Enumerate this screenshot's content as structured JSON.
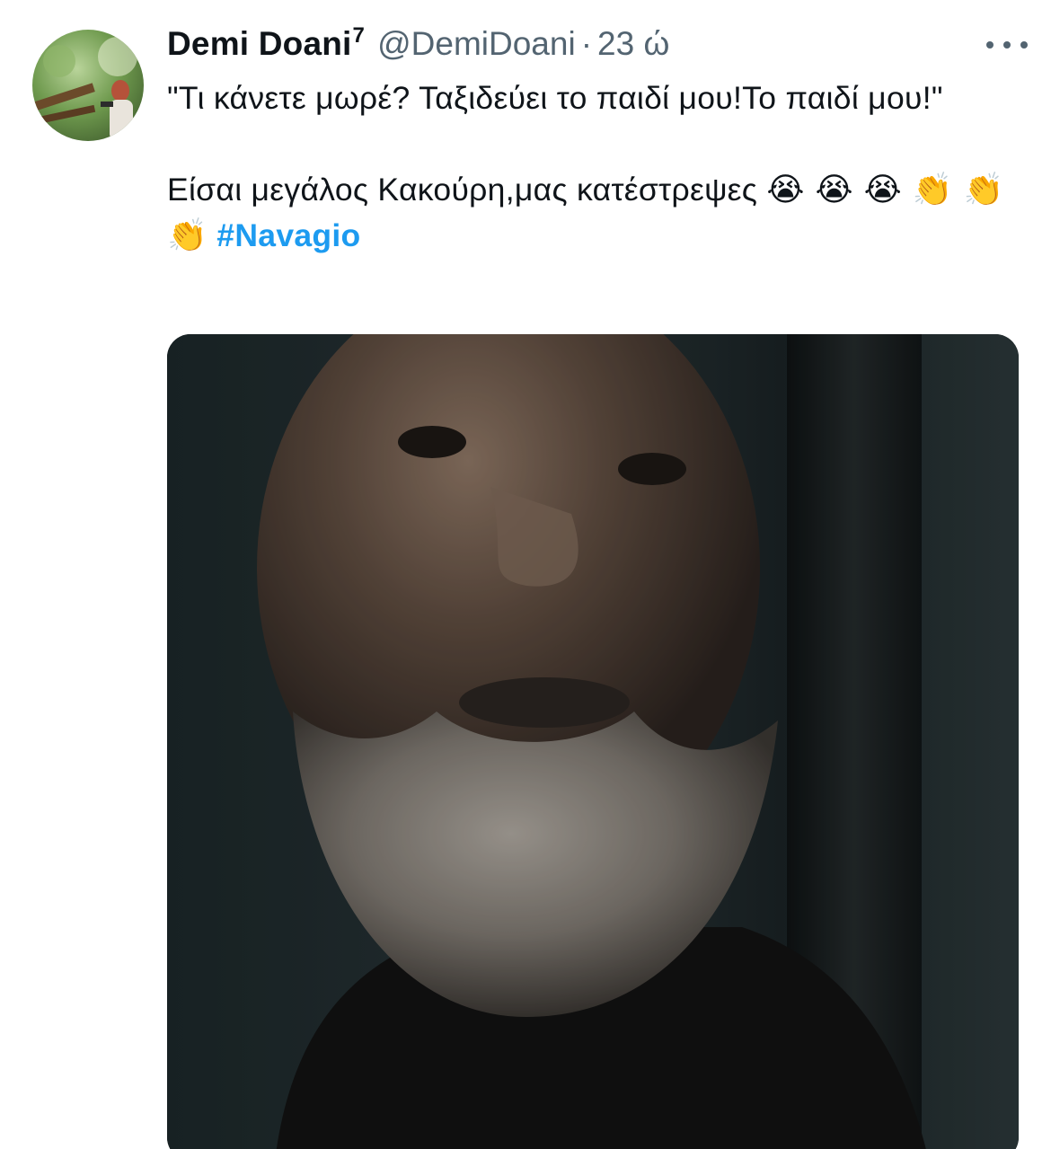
{
  "tweet": {
    "display_name": "Demi Doani",
    "badge": "7",
    "handle": "@DemiDoani",
    "separator": "·",
    "time": "23 ώ",
    "text_line1": "\"Τι κάνετε μωρέ? Ταξιδεύει το παιδί μου!Το παιδί μου!\"",
    "text_line2_prefix": "Είσαι μεγάλος Κακούρη,μας κατέστρεψες",
    "emojis": "😭 😭 😭 👏 👏 👏",
    "hashtag": "#Navagio"
  },
  "icons": {
    "more": "more-horizontal-icon"
  },
  "colors": {
    "text": "#0f1419",
    "secondary": "#536471",
    "link": "#1d9bf0",
    "background": "#ffffff"
  }
}
